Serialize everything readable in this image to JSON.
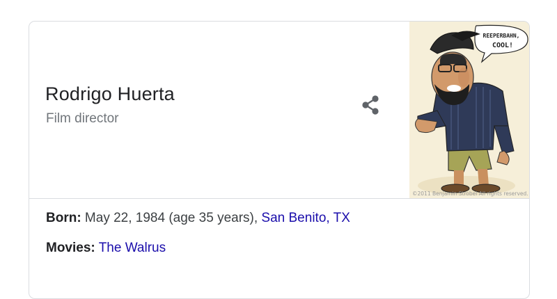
{
  "entity": {
    "name": "Rodrigo Huerta",
    "subtitle": "Film director"
  },
  "image": {
    "speech_bubble_line1": "REEPERBAHN,",
    "speech_bubble_line2": "COOL!",
    "credit": "©2011 Benjamin Strobel All rights reserved."
  },
  "facts": {
    "born": {
      "label": "Born:",
      "value": " May 22, 1984 (age 35 years), ",
      "place": "San Benito, TX"
    },
    "movies": {
      "label": "Movies:",
      "value": " ",
      "title": "The Walrus"
    }
  },
  "icons": {
    "share": "share-icon"
  },
  "colors": {
    "link": "#1a0dab",
    "title": "#202124",
    "subtitle": "#70757a",
    "border": "#dadce0"
  }
}
